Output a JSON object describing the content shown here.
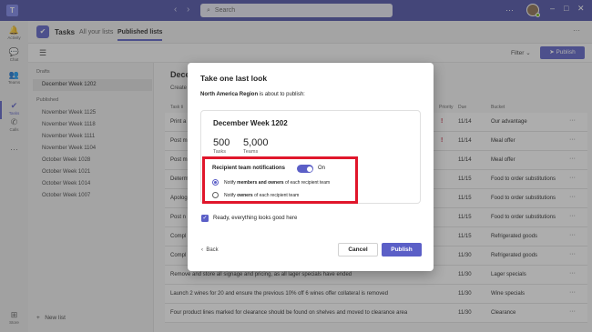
{
  "app": {
    "logo_glyph": "T",
    "search_placeholder": "Search",
    "more_glyph": "···",
    "accent": "#5b5fc7",
    "titlebar_color": "#4b4fa6"
  },
  "rail": [
    {
      "label": "Activity",
      "icon": "bell-icon",
      "glyph": "🔔"
    },
    {
      "label": "Chat",
      "icon": "chat-icon",
      "glyph": "💬"
    },
    {
      "label": "Teams",
      "icon": "teams-icon",
      "glyph": "👥"
    },
    {
      "label": "Tasks",
      "icon": "tasks-icon",
      "glyph": "✔"
    },
    {
      "label": "Calls",
      "icon": "phone-icon",
      "glyph": "✆"
    },
    {
      "label": "",
      "icon": "more-icon",
      "glyph": "···"
    },
    {
      "label": "Store",
      "icon": "store-icon",
      "glyph": "⊞"
    }
  ],
  "header": {
    "title": "Tasks",
    "tabs": [
      "All your lists",
      "Published lists"
    ],
    "selected_tab": "Published lists"
  },
  "toolbar": {
    "filter": "Filter",
    "publish": "Publish"
  },
  "sidebar": {
    "drafts_label": "Drafts",
    "drafts": [
      "December Week 1202"
    ],
    "published_label": "Published",
    "published": [
      "November Week 1125",
      "November Week 1118",
      "November Week 1111",
      "November Week 1104",
      "October Week 1028",
      "October Week 1021",
      "October Week 1014",
      "October Week 1007"
    ],
    "new_list": "New list"
  },
  "main": {
    "title": "Dece",
    "subtitle": "Create",
    "columns": {
      "task": "Task ti",
      "priority": "Priority",
      "due": "Due",
      "bucket": "Bucket"
    },
    "rows": [
      {
        "task": "Print a",
        "priority": "!",
        "due": "11/14",
        "bucket": "Our advantage"
      },
      {
        "task": "Post m",
        "priority": "!",
        "due": "11/14",
        "bucket": "Meal offer"
      },
      {
        "task": "Post m",
        "priority": "",
        "due": "11/14",
        "bucket": "Meal offer"
      },
      {
        "task": "Determ",
        "priority": "",
        "due": "11/15",
        "bucket": "Food to order substitutions"
      },
      {
        "task": "Apolog",
        "priority": "",
        "due": "11/15",
        "bucket": "Food to order substitutions"
      },
      {
        "task": "Post n",
        "priority": "",
        "due": "11/15",
        "bucket": "Food to order substitutions"
      },
      {
        "task": "Compl",
        "priority": "",
        "due": "11/15",
        "bucket": "Refrigerated goods"
      },
      {
        "task": "Compl",
        "priority": "",
        "due": "11/30",
        "bucket": "Refrigerated goods"
      },
      {
        "task": "Remove and store all signage and pricing, as all lager specials have ended",
        "priority": "",
        "due": "11/30",
        "bucket": "Lager specials"
      },
      {
        "task": "Launch 2 wines for 20 and ensure the previous 10% off 6 wines offer collateral is removed",
        "priority": "",
        "due": "11/30",
        "bucket": "Wine specials"
      },
      {
        "task": "Four product lines marked for clearance should be found on shelves and moved to clearance area",
        "priority": "",
        "due": "11/30",
        "bucket": "Clearance"
      }
    ]
  },
  "dialog": {
    "title": "Take one last look",
    "intro_bold": "North America Region",
    "intro_rest": " is about to publish:",
    "card_title": "December Week 1202",
    "stat1_value": "500",
    "stat1_label": "Tasks",
    "stat2_value": "5,000",
    "stat2_label": "Teams",
    "notif_label": "Recipient team notifications",
    "toggle_label": "On",
    "toggle_on": true,
    "option1_pre": "Notify ",
    "option1_bold": "members and owners",
    "option1_post": " of each recipient team",
    "option2_pre": "Notify ",
    "option2_bold": "owners",
    "option2_post": " of each recipient team",
    "selected_option": 1,
    "checkbox_label": "Ready, everything looks good here",
    "checkbox_checked": true,
    "back": "Back",
    "cancel": "Cancel",
    "publish": "Publish"
  }
}
